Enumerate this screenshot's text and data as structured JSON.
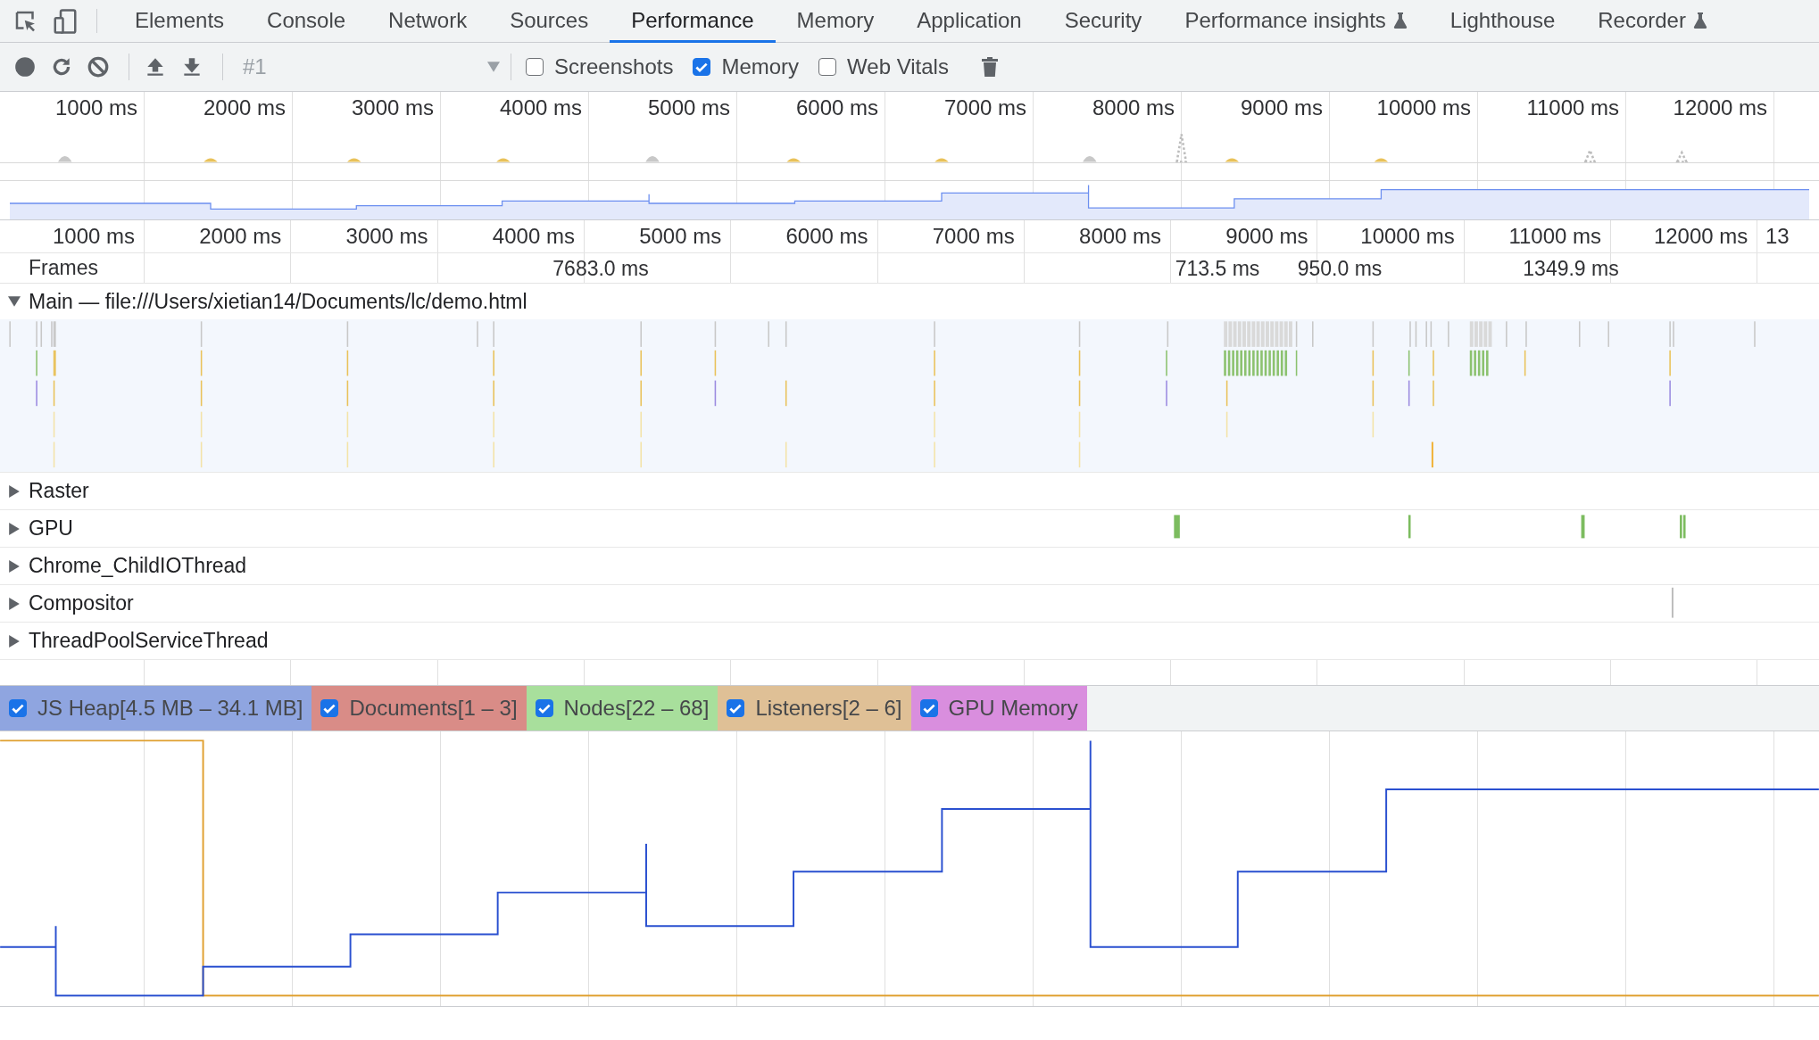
{
  "tabs": [
    {
      "label": "Elements",
      "selected": false,
      "experimental": false
    },
    {
      "label": "Console",
      "selected": false,
      "experimental": false
    },
    {
      "label": "Network",
      "selected": false,
      "experimental": false
    },
    {
      "label": "Sources",
      "selected": false,
      "experimental": false
    },
    {
      "label": "Performance",
      "selected": true,
      "experimental": false
    },
    {
      "label": "Memory",
      "selected": false,
      "experimental": false
    },
    {
      "label": "Application",
      "selected": false,
      "experimental": false
    },
    {
      "label": "Security",
      "selected": false,
      "experimental": false
    },
    {
      "label": "Performance insights",
      "selected": false,
      "experimental": true
    },
    {
      "label": "Lighthouse",
      "selected": false,
      "experimental": false
    },
    {
      "label": "Recorder",
      "selected": false,
      "experimental": true
    }
  ],
  "toolbar": {
    "recording": "#1",
    "options": [
      {
        "label": "Screenshots",
        "checked": false
      },
      {
        "label": "Memory",
        "checked": true
      },
      {
        "label": "Web Vitals",
        "checked": false
      }
    ]
  },
  "overview": {
    "ticks": [
      "1000 ms",
      "2000 ms",
      "3000 ms",
      "4000 ms",
      "5000 ms",
      "6000 ms",
      "7000 ms",
      "8000 ms",
      "9000 ms",
      "10000 ms",
      "11000 ms",
      "12000 ms"
    ]
  },
  "ruler": {
    "ticks": [
      "1000 ms",
      "2000 ms",
      "3000 ms",
      "4000 ms",
      "5000 ms",
      "6000 ms",
      "7000 ms",
      "8000 ms",
      "9000 ms",
      "10000 ms",
      "11000 ms",
      "12000 ms",
      "13"
    ]
  },
  "frames": {
    "label": "Frames",
    "durations": [
      "7683.0 ms",
      "713.5 ms",
      "950.0 ms",
      "1349.9 ms"
    ]
  },
  "tracks": [
    {
      "name": "Main — file:///Users/xietian14/Documents/lc/demo.html",
      "expanded": true
    },
    {
      "name": "Raster",
      "expanded": false
    },
    {
      "name": "GPU",
      "expanded": false
    },
    {
      "name": "Chrome_ChildIOThread",
      "expanded": false
    },
    {
      "name": "Compositor",
      "expanded": false
    },
    {
      "name": "ThreadPoolServiceThread",
      "expanded": false
    }
  ],
  "memory_counters": [
    {
      "label": "JS Heap[4.5 MB – 34.1 MB]",
      "checked": true,
      "color": "#8fa5e0"
    },
    {
      "label": "Documents[1 – 3]",
      "checked": true,
      "color": "#d98c87"
    },
    {
      "label": "Nodes[22 – 68]",
      "checked": true,
      "color": "#a8df9c"
    },
    {
      "label": "Listeners[2 – 6]",
      "checked": true,
      "color": "#dfc096"
    },
    {
      "label": "GPU Memory",
      "checked": true,
      "color": "#d98ede"
    }
  ]
}
